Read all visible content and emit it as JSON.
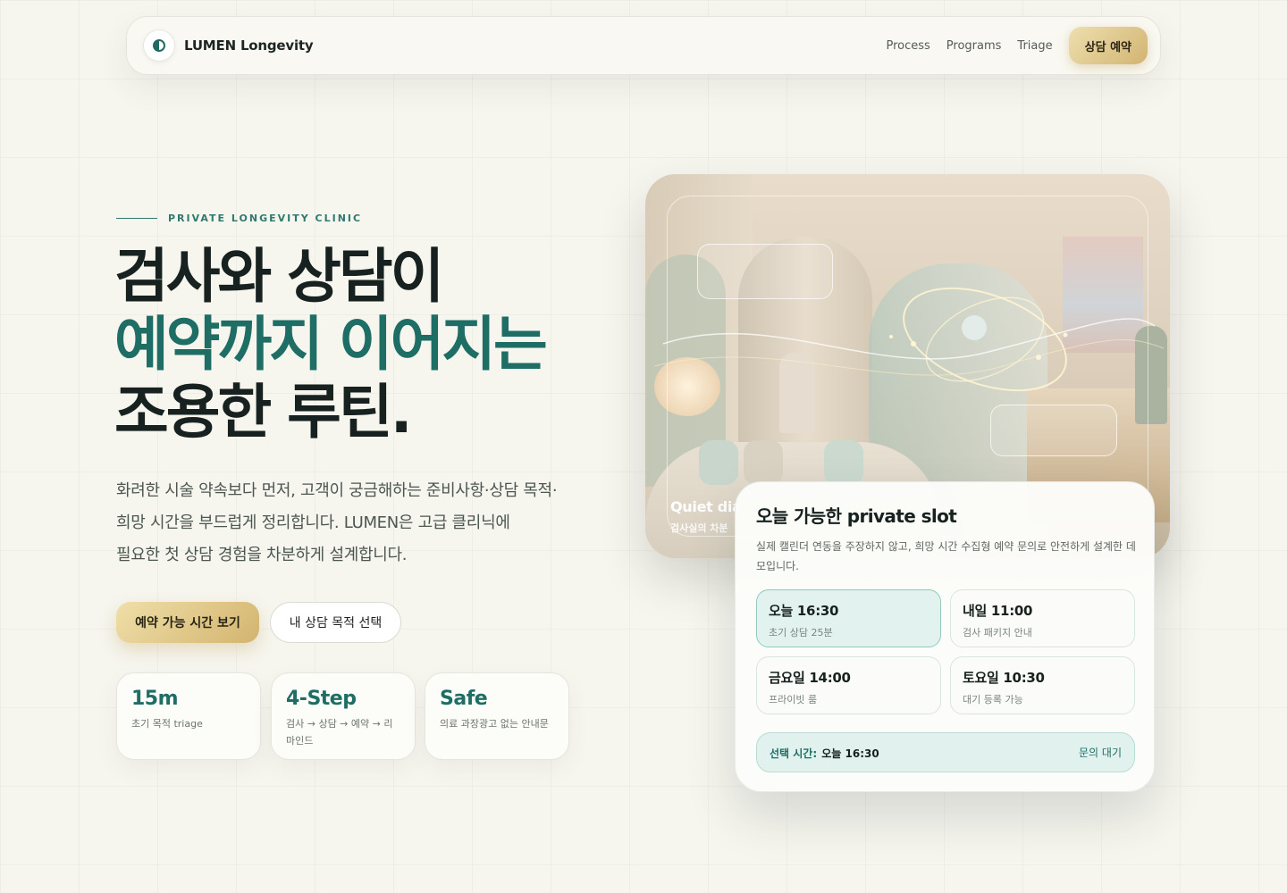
{
  "nav": {
    "brand": "LUMEN Longevity",
    "links": [
      "Process",
      "Programs",
      "Triage"
    ],
    "cta": "상담 예약"
  },
  "hero": {
    "eyebrow": "PRIVATE LONGEVITY CLINIC",
    "title_line1": "검사와 상담이",
    "title_line2": "예약까지 이어지는",
    "title_line3": "조용한 루틴.",
    "desc_line1": "화려한 시술 약속보다 먼저, 고객이 궁금해하는 준비사항·상담 목적·",
    "desc_line2": "희망 시간을 부드럽게 정리합니다. LUMEN은 고급 클리닉에",
    "desc_line3": "필요한 첫 상담 경험을 차분하게 설계합니다.",
    "primary_button": "예약 가능 시간 보기",
    "secondary_button": "내 상담 목적 선택"
  },
  "stats": [
    {
      "value": "15m",
      "label": "초기 목적 triage"
    },
    {
      "value": "4-Step",
      "label": "검사 → 상담 → 예약 → 리마인드"
    },
    {
      "value": "Safe",
      "label": "의료 과장광고 없는 안내문"
    }
  ],
  "photo": {
    "caption_title": "Quiet dia",
    "caption_sub": "검사실의 차분"
  },
  "slot_card": {
    "title": "오늘 가능한 private slot",
    "desc": "실제 캘린더 연동을 주장하지 않고, 희망 시간 수집형 예약 문의로 안전하게 설계한 데모입니다.",
    "slots": [
      {
        "time": "오늘 16:30",
        "note": "초기 상담 25분",
        "selected": true
      },
      {
        "time": "내일 11:00",
        "note": "검사 패키지 안내",
        "selected": false
      },
      {
        "time": "금요일 14:00",
        "note": "프라이빗 룸",
        "selected": false
      },
      {
        "time": "토요일 10:30",
        "note": "대기 등록 가능",
        "selected": false
      }
    ],
    "selected_label": "선택 시간:",
    "selected_value": "오늘 16:30",
    "status": "문의 대기"
  },
  "colors": {
    "accent_teal": "#1f6e66",
    "gold": "#d3b46f",
    "background": "#f6f5ee"
  }
}
